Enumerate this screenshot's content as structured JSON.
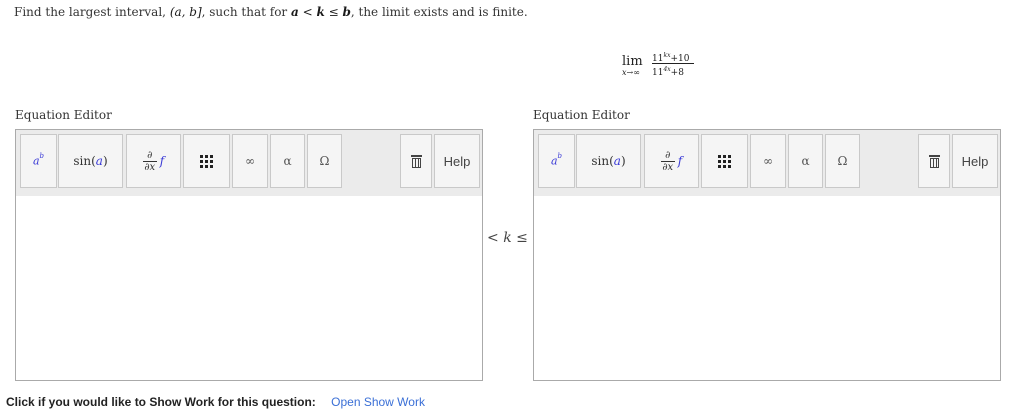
{
  "question": {
    "prefix": "Find the largest interval,",
    "interval": "(a, b]",
    "mid": ", such that for",
    "cond_a": "a",
    "cond_lt": " < ",
    "cond_k": "k",
    "cond_le": " ≤ ",
    "cond_b": "b",
    "suffix": ", the limit exists and is finite."
  },
  "limit": {
    "lim": "lim",
    "sub": "x→∞",
    "num_base": "11",
    "num_exp": "kx",
    "num_rest": "+10",
    "den_base": "11",
    "den_exp": "4x",
    "den_rest": "+8"
  },
  "editors": [
    {
      "title": "Equation Editor",
      "help_label": "Help"
    },
    {
      "title": "Equation Editor",
      "help_label": "Help"
    }
  ],
  "toolbar": {
    "power_base": "a",
    "power_exp": "b",
    "sin_fn": "sin(",
    "sin_arg": "a",
    "sin_close": ")",
    "deriv_top": "∂",
    "deriv_bottom": "∂x",
    "deriv_f": "f",
    "infinity": "∞",
    "alpha": "α",
    "omega": "Ω"
  },
  "between": {
    "lt": "<",
    "k": "k",
    "le": "≤"
  },
  "show_work": {
    "prompt": "Click if you would like to Show Work for this question:",
    "link": "Open Show Work"
  },
  "colors": {
    "toolbar_bg": "#ebebeb",
    "accent_blue": "#3a3ad6",
    "link_blue": "#3a6fd6"
  }
}
